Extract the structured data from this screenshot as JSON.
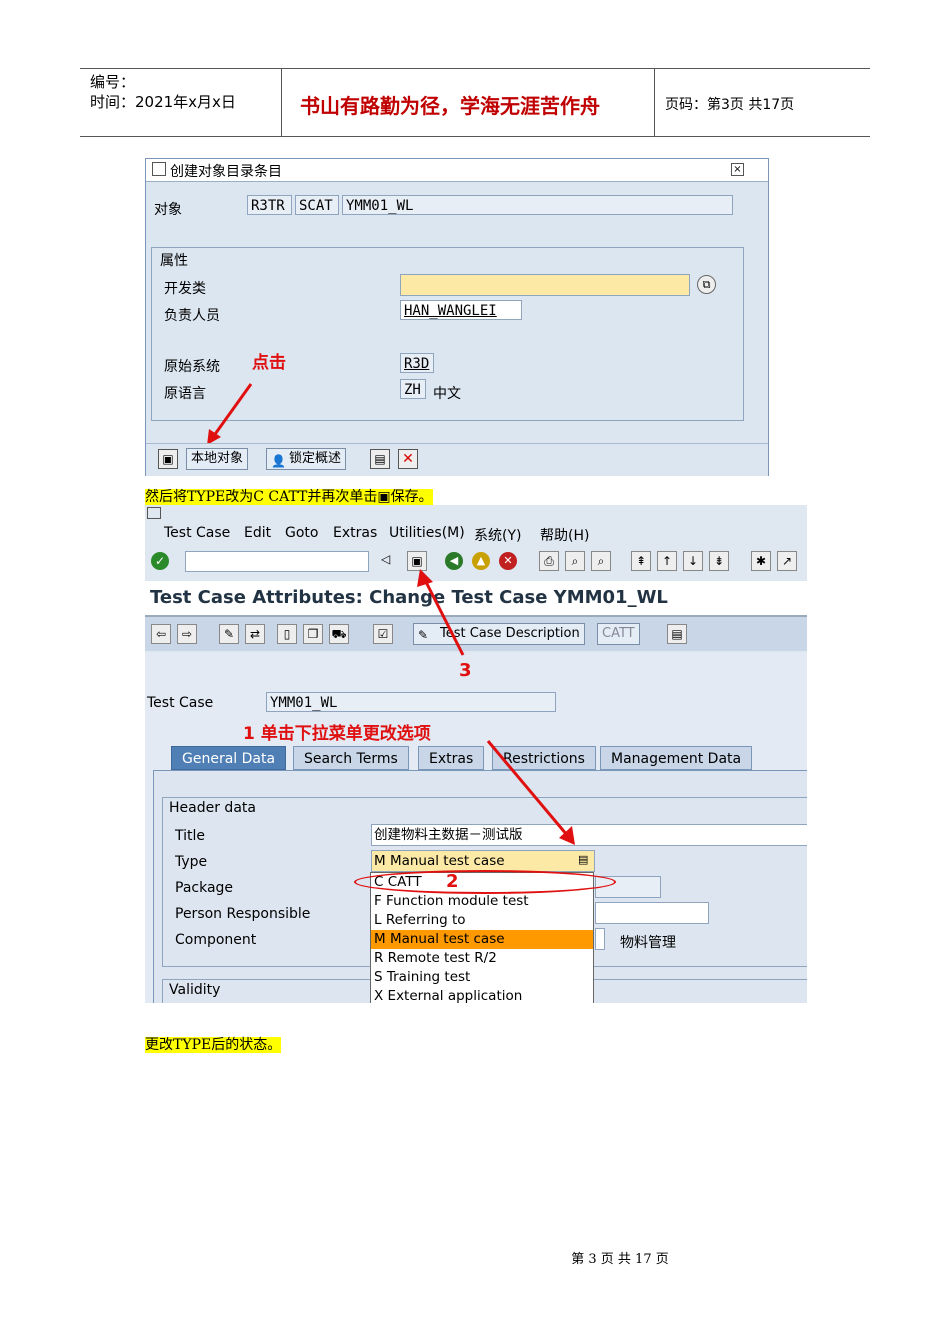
{
  "header": {
    "number_label": "编号：",
    "time_label": "时间：2021年x月x日",
    "motto": "书山有路勤为径，学海无涯苦作舟",
    "page_info": "页码：第3页  共17页"
  },
  "dialog1": {
    "title": "创建对象目录条目",
    "object_label": "对象",
    "object_fields": [
      "R3TR",
      "SCAT",
      "YMM01_WL"
    ],
    "attributes_group": "属性",
    "dev_class_label": "开发类",
    "dev_class_value": "",
    "owner_label": "负责人员",
    "owner_value": "HAN_WANGLEI",
    "orig_system_label": "原始系统",
    "orig_system_value": "R3D",
    "orig_lang_label": "原语言",
    "orig_lang_code": "ZH",
    "orig_lang_name": "中文",
    "click_note": "点击",
    "local_object_button": "本地对象",
    "lock_overview_button": "锁定概述"
  },
  "instruction1": "然后将TYPE改为C CATT并再次单击",
  "instruction1_tail": "保存。",
  "window2": {
    "menu": [
      "Test Case",
      "Edit",
      "Goto",
      "Extras",
      "Utilities(M)",
      "系统(Y)",
      "帮助(H)"
    ],
    "title": "Test Case Attributes: Change Test Case YMM01_WL",
    "desc_button": "Test Case Description",
    "catt_button": "CATT",
    "annotation_3": "3",
    "test_case_label": "Test Case",
    "test_case_value": "YMM01_WL",
    "annotation_1": "1  单击下拉菜单更改选项",
    "tabs": [
      "General Data",
      "Search Terms",
      "Extras",
      "Restrictions",
      "Management Data"
    ],
    "header_group": "Header data",
    "labels": [
      "Title",
      "Type",
      "Package",
      "Person Responsible",
      "Component"
    ],
    "title_value": "创建物料主数据－测试版",
    "type_value": "M Manual test case",
    "component_value": "物料管理",
    "annotation_2": "2",
    "dropdown": [
      "C  CATT",
      "F  Function module test",
      "L  Referring to",
      "M Manual test case",
      "R  Remote test R/2",
      "S  Training test",
      "X  External application"
    ],
    "validity_group": "Validity"
  },
  "instruction2": "更改TYPE后的状态。",
  "footer": "第 3 页 共 17 页"
}
